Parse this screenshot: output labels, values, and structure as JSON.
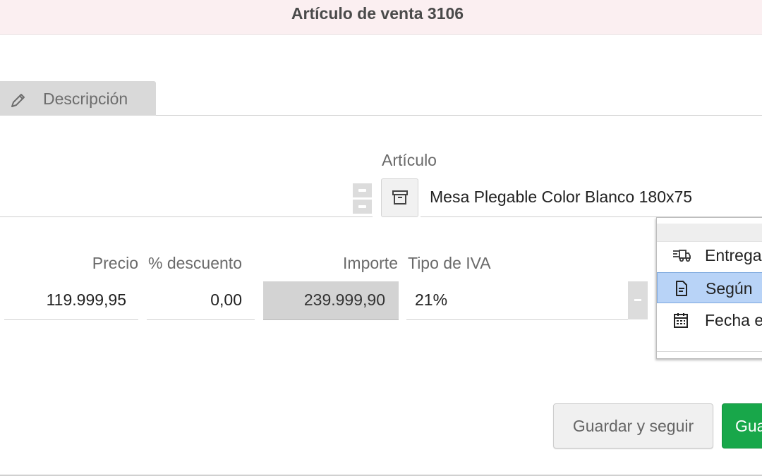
{
  "header": {
    "title": "Artículo de venta 3106"
  },
  "tabs": [
    {
      "label": "Descripción",
      "icon": "pencil-icon"
    }
  ],
  "fields": {
    "articulo": {
      "label": "Artículo",
      "value": "Mesa Plegable Color Blanco 180x75",
      "button_icon": "archive-icon"
    },
    "precio": {
      "label": "Precio",
      "value": "119.999,95"
    },
    "descuento": {
      "label": "% descuento",
      "value": "0,00"
    },
    "importe": {
      "label": "Importe",
      "value": "239.999,90"
    },
    "tipo_iva": {
      "label": "Tipo de IVA",
      "value": "21%"
    }
  },
  "dropdown": {
    "items": [
      {
        "label": "Entrega",
        "icon": "truck-icon",
        "selected": false
      },
      {
        "label": "Según",
        "icon": "document-icon",
        "selected": true
      },
      {
        "label": "Fecha e",
        "icon": "calendar-icon",
        "selected": false
      }
    ]
  },
  "buttons": {
    "save_continue": "Guardar y seguir",
    "save": "Gua"
  },
  "colors": {
    "header_bg": "#fbeff1",
    "save_button": "#18a74a",
    "selected_item": "#b8d3f7",
    "readonly_field": "#d3d3d3"
  }
}
